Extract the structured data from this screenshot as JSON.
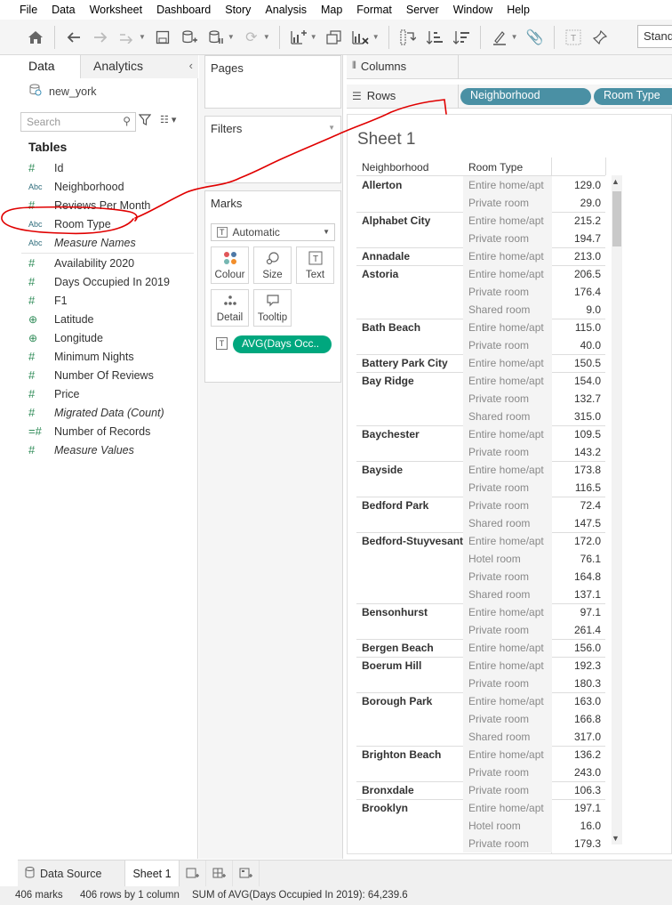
{
  "menu": [
    "File",
    "Data",
    "Worksheet",
    "Dashboard",
    "Story",
    "Analysis",
    "Map",
    "Format",
    "Server",
    "Window",
    "Help"
  ],
  "toolbar": {
    "standard_label": "Standard"
  },
  "data_pane": {
    "tab_data": "Data",
    "tab_analytics": "Analytics",
    "datasource": "new_york",
    "search_placeholder": "Search",
    "tables_heading": "Tables",
    "dimensions": [
      {
        "type": "#",
        "name": "Id"
      },
      {
        "type": "Abc",
        "name": "Neighborhood"
      },
      {
        "type": "#",
        "name": "Reviews Per Month"
      },
      {
        "type": "Abc",
        "name": "Room Type"
      },
      {
        "type": "Abc",
        "name": "Measure Names"
      }
    ],
    "measures": [
      {
        "type": "#",
        "name": "Availability 2020"
      },
      {
        "type": "#",
        "name": "Days Occupied In 2019"
      },
      {
        "type": "#",
        "name": "F1"
      },
      {
        "type": "geo",
        "name": "Latitude"
      },
      {
        "type": "geo",
        "name": "Longitude"
      },
      {
        "type": "#",
        "name": "Minimum Nights"
      },
      {
        "type": "#",
        "name": "Number Of Reviews"
      },
      {
        "type": "#",
        "name": "Price"
      },
      {
        "type": "#",
        "name": "Migrated Data (Count)"
      },
      {
        "type": "=#",
        "name": "Number of Records"
      },
      {
        "type": "#",
        "name": "Measure Values"
      }
    ]
  },
  "cards": {
    "pages": "Pages",
    "filters": "Filters",
    "marks": "Marks",
    "mark_type": "Automatic",
    "buttons": [
      "Colour",
      "Size",
      "Text",
      "Detail",
      "Tooltip"
    ],
    "measure_pill": "AVG(Days Occ.."
  },
  "shelves": {
    "columns_label": "Columns",
    "rows_label": "Rows",
    "row_pills": [
      "Neighborhood",
      "Room Type"
    ]
  },
  "sheet": {
    "title": "Sheet 1",
    "header_neighborhood": "Neighborhood",
    "header_room_type": "Room Type",
    "groups": [
      {
        "name": "Allerton",
        "rows": [
          [
            "Entire home/apt",
            "129.0"
          ],
          [
            "Private room",
            "29.0"
          ]
        ]
      },
      {
        "name": "Alphabet City",
        "rows": [
          [
            "Entire home/apt",
            "215.2"
          ],
          [
            "Private room",
            "194.7"
          ]
        ]
      },
      {
        "name": "Annadale",
        "rows": [
          [
            "Entire home/apt",
            "213.0"
          ]
        ]
      },
      {
        "name": "Astoria",
        "rows": [
          [
            "Entire home/apt",
            "206.5"
          ],
          [
            "Private room",
            "176.4"
          ],
          [
            "Shared room",
            "9.0"
          ]
        ]
      },
      {
        "name": "Bath Beach",
        "rows": [
          [
            "Entire home/apt",
            "115.0"
          ],
          [
            "Private room",
            "40.0"
          ]
        ]
      },
      {
        "name": "Battery Park City",
        "rows": [
          [
            "Entire home/apt",
            "150.5"
          ]
        ]
      },
      {
        "name": "Bay Ridge",
        "rows": [
          [
            "Entire home/apt",
            "154.0"
          ],
          [
            "Private room",
            "132.7"
          ],
          [
            "Shared room",
            "315.0"
          ]
        ]
      },
      {
        "name": "Baychester",
        "rows": [
          [
            "Entire home/apt",
            "109.5"
          ],
          [
            "Private room",
            "143.2"
          ]
        ]
      },
      {
        "name": "Bayside",
        "rows": [
          [
            "Entire home/apt",
            "173.8"
          ],
          [
            "Private room",
            "116.5"
          ]
        ]
      },
      {
        "name": "Bedford Park",
        "rows": [
          [
            "Private room",
            "72.4"
          ],
          [
            "Shared room",
            "147.5"
          ]
        ]
      },
      {
        "name": "Bedford-Stuyvesant",
        "rows": [
          [
            "Entire home/apt",
            "172.0"
          ],
          [
            "Hotel room",
            "76.1"
          ],
          [
            "Private room",
            "164.8"
          ],
          [
            "Shared room",
            "137.1"
          ]
        ]
      },
      {
        "name": "Bensonhurst",
        "rows": [
          [
            "Entire home/apt",
            "97.1"
          ],
          [
            "Private room",
            "261.4"
          ]
        ]
      },
      {
        "name": "Bergen Beach",
        "rows": [
          [
            "Entire home/apt",
            "156.0"
          ]
        ]
      },
      {
        "name": "Boerum Hill",
        "rows": [
          [
            "Entire home/apt",
            "192.3"
          ],
          [
            "Private room",
            "180.3"
          ]
        ]
      },
      {
        "name": "Borough Park",
        "rows": [
          [
            "Entire home/apt",
            "163.0"
          ],
          [
            "Private room",
            "166.8"
          ],
          [
            "Shared room",
            "317.0"
          ]
        ]
      },
      {
        "name": "Brighton Beach",
        "rows": [
          [
            "Entire home/apt",
            "136.2"
          ],
          [
            "Private room",
            "243.0"
          ]
        ]
      },
      {
        "name": "Bronxdale",
        "rows": [
          [
            "Private room",
            "106.3"
          ]
        ]
      },
      {
        "name": "Brooklyn",
        "rows": [
          [
            "Entire home/apt",
            "197.1"
          ],
          [
            "Hotel room",
            "16.0"
          ],
          [
            "Private room",
            "179.3"
          ]
        ]
      }
    ]
  },
  "bottom_tabs": {
    "data_source": "Data Source",
    "sheet": "Sheet 1"
  },
  "status": {
    "marks": "406 marks",
    "rows": "406 rows by 1 column",
    "sum": "SUM of AVG(Days Occupied In 2019): 64,239.6"
  },
  "colors": {
    "pill_blue": "#4a90a4",
    "pill_green": "#00a77e",
    "annotation": "#e00000"
  }
}
